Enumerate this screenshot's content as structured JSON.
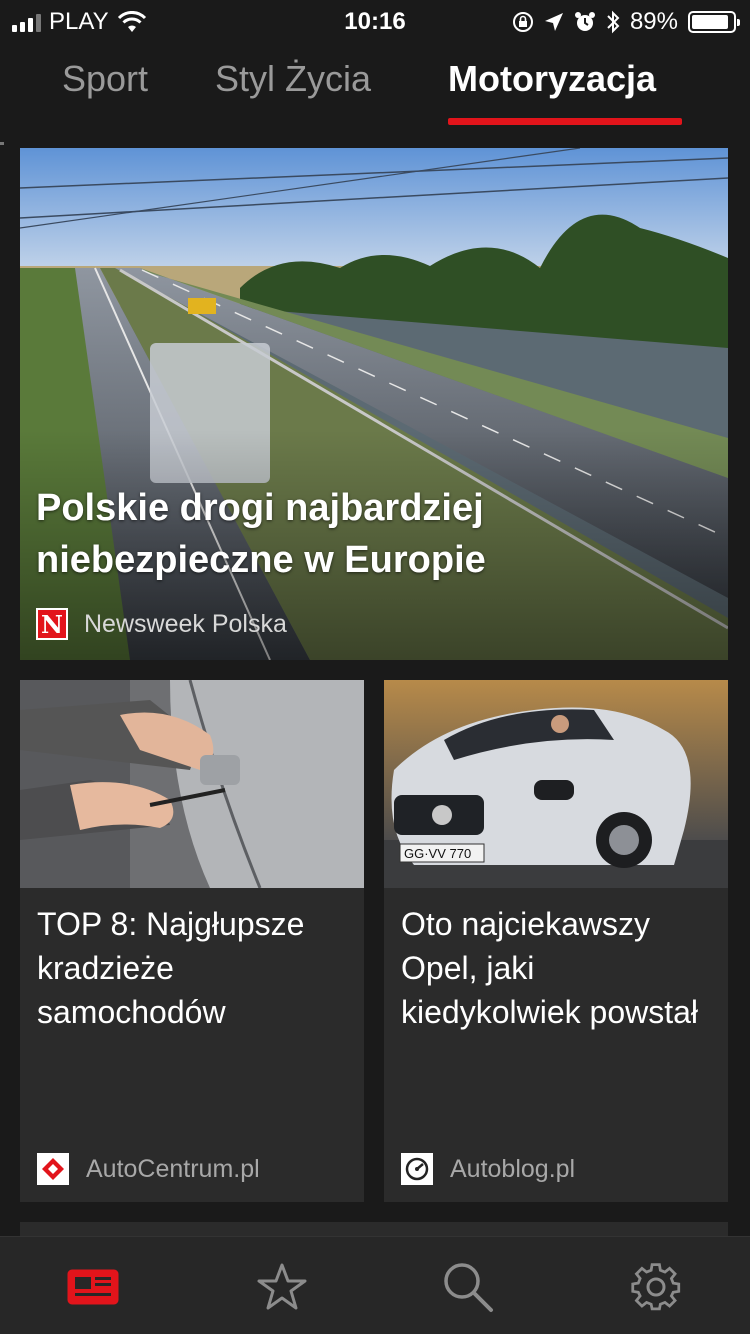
{
  "status_bar": {
    "carrier": "PLAY",
    "time": "10:16",
    "battery_percent": "89%",
    "battery_level": 0.89,
    "icons": [
      "signal-icon",
      "wifi-icon",
      "orientation-lock-icon",
      "location-icon",
      "alarm-icon",
      "bluetooth-icon",
      "battery-icon"
    ]
  },
  "tabs": [
    {
      "label": "Sport",
      "active": false
    },
    {
      "label": "Styl Życia",
      "active": false
    },
    {
      "label": "Motoryzacja",
      "active": true
    }
  ],
  "hero": {
    "title": "Polskie drogi najbardziej niebezpieczne w Europie",
    "source": "Newsweek Polska",
    "source_logo_letter": "N"
  },
  "cards": [
    {
      "title": "TOP 8: Najgłupsze kradzieże samochodów",
      "source": "AutoCentrum.pl"
    },
    {
      "title": "Oto najciekawszy Opel, jaki kiedykolwiek powstał",
      "source": "Autoblog.pl",
      "plate": "GG·VV 770"
    }
  ],
  "tabbar": {
    "items": [
      "news-icon",
      "favorites-star-icon",
      "search-icon",
      "settings-gear-icon"
    ],
    "active": "news-icon"
  },
  "colors": {
    "accent": "#e2141b",
    "background": "#1a1a1a",
    "card": "#2b2b2b",
    "tabbar": "#272727"
  }
}
